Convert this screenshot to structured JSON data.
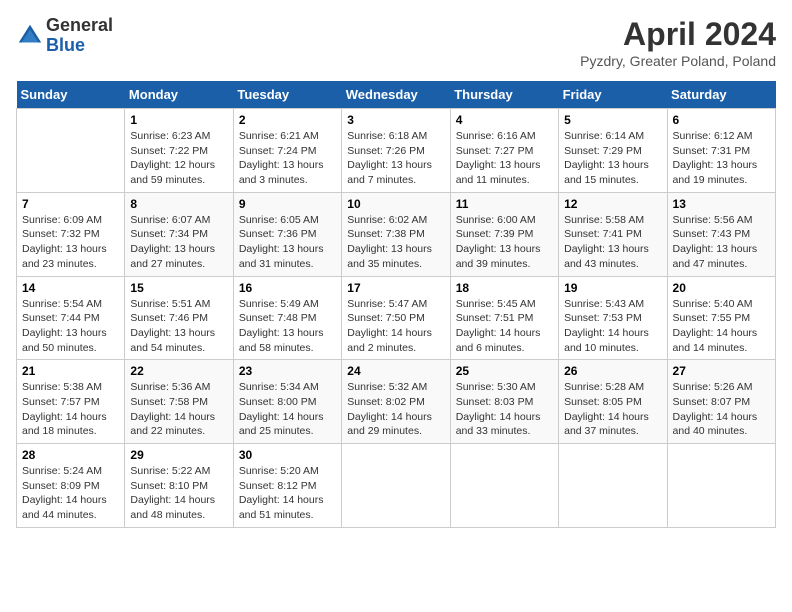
{
  "header": {
    "logo_general": "General",
    "logo_blue": "Blue",
    "title": "April 2024",
    "subtitle": "Pyzdry, Greater Poland, Poland"
  },
  "days_of_week": [
    "Sunday",
    "Monday",
    "Tuesday",
    "Wednesday",
    "Thursday",
    "Friday",
    "Saturday"
  ],
  "weeks": [
    [
      {
        "num": "",
        "sunrise": "",
        "sunset": "",
        "daylight": ""
      },
      {
        "num": "1",
        "sunrise": "Sunrise: 6:23 AM",
        "sunset": "Sunset: 7:22 PM",
        "daylight": "Daylight: 12 hours and 59 minutes."
      },
      {
        "num": "2",
        "sunrise": "Sunrise: 6:21 AM",
        "sunset": "Sunset: 7:24 PM",
        "daylight": "Daylight: 13 hours and 3 minutes."
      },
      {
        "num": "3",
        "sunrise": "Sunrise: 6:18 AM",
        "sunset": "Sunset: 7:26 PM",
        "daylight": "Daylight: 13 hours and 7 minutes."
      },
      {
        "num": "4",
        "sunrise": "Sunrise: 6:16 AM",
        "sunset": "Sunset: 7:27 PM",
        "daylight": "Daylight: 13 hours and 11 minutes."
      },
      {
        "num": "5",
        "sunrise": "Sunrise: 6:14 AM",
        "sunset": "Sunset: 7:29 PM",
        "daylight": "Daylight: 13 hours and 15 minutes."
      },
      {
        "num": "6",
        "sunrise": "Sunrise: 6:12 AM",
        "sunset": "Sunset: 7:31 PM",
        "daylight": "Daylight: 13 hours and 19 minutes."
      }
    ],
    [
      {
        "num": "7",
        "sunrise": "Sunrise: 6:09 AM",
        "sunset": "Sunset: 7:32 PM",
        "daylight": "Daylight: 13 hours and 23 minutes."
      },
      {
        "num": "8",
        "sunrise": "Sunrise: 6:07 AM",
        "sunset": "Sunset: 7:34 PM",
        "daylight": "Daylight: 13 hours and 27 minutes."
      },
      {
        "num": "9",
        "sunrise": "Sunrise: 6:05 AM",
        "sunset": "Sunset: 7:36 PM",
        "daylight": "Daylight: 13 hours and 31 minutes."
      },
      {
        "num": "10",
        "sunrise": "Sunrise: 6:02 AM",
        "sunset": "Sunset: 7:38 PM",
        "daylight": "Daylight: 13 hours and 35 minutes."
      },
      {
        "num": "11",
        "sunrise": "Sunrise: 6:00 AM",
        "sunset": "Sunset: 7:39 PM",
        "daylight": "Daylight: 13 hours and 39 minutes."
      },
      {
        "num": "12",
        "sunrise": "Sunrise: 5:58 AM",
        "sunset": "Sunset: 7:41 PM",
        "daylight": "Daylight: 13 hours and 43 minutes."
      },
      {
        "num": "13",
        "sunrise": "Sunrise: 5:56 AM",
        "sunset": "Sunset: 7:43 PM",
        "daylight": "Daylight: 13 hours and 47 minutes."
      }
    ],
    [
      {
        "num": "14",
        "sunrise": "Sunrise: 5:54 AM",
        "sunset": "Sunset: 7:44 PM",
        "daylight": "Daylight: 13 hours and 50 minutes."
      },
      {
        "num": "15",
        "sunrise": "Sunrise: 5:51 AM",
        "sunset": "Sunset: 7:46 PM",
        "daylight": "Daylight: 13 hours and 54 minutes."
      },
      {
        "num": "16",
        "sunrise": "Sunrise: 5:49 AM",
        "sunset": "Sunset: 7:48 PM",
        "daylight": "Daylight: 13 hours and 58 minutes."
      },
      {
        "num": "17",
        "sunrise": "Sunrise: 5:47 AM",
        "sunset": "Sunset: 7:50 PM",
        "daylight": "Daylight: 14 hours and 2 minutes."
      },
      {
        "num": "18",
        "sunrise": "Sunrise: 5:45 AM",
        "sunset": "Sunset: 7:51 PM",
        "daylight": "Daylight: 14 hours and 6 minutes."
      },
      {
        "num": "19",
        "sunrise": "Sunrise: 5:43 AM",
        "sunset": "Sunset: 7:53 PM",
        "daylight": "Daylight: 14 hours and 10 minutes."
      },
      {
        "num": "20",
        "sunrise": "Sunrise: 5:40 AM",
        "sunset": "Sunset: 7:55 PM",
        "daylight": "Daylight: 14 hours and 14 minutes."
      }
    ],
    [
      {
        "num": "21",
        "sunrise": "Sunrise: 5:38 AM",
        "sunset": "Sunset: 7:57 PM",
        "daylight": "Daylight: 14 hours and 18 minutes."
      },
      {
        "num": "22",
        "sunrise": "Sunrise: 5:36 AM",
        "sunset": "Sunset: 7:58 PM",
        "daylight": "Daylight: 14 hours and 22 minutes."
      },
      {
        "num": "23",
        "sunrise": "Sunrise: 5:34 AM",
        "sunset": "Sunset: 8:00 PM",
        "daylight": "Daylight: 14 hours and 25 minutes."
      },
      {
        "num": "24",
        "sunrise": "Sunrise: 5:32 AM",
        "sunset": "Sunset: 8:02 PM",
        "daylight": "Daylight: 14 hours and 29 minutes."
      },
      {
        "num": "25",
        "sunrise": "Sunrise: 5:30 AM",
        "sunset": "Sunset: 8:03 PM",
        "daylight": "Daylight: 14 hours and 33 minutes."
      },
      {
        "num": "26",
        "sunrise": "Sunrise: 5:28 AM",
        "sunset": "Sunset: 8:05 PM",
        "daylight": "Daylight: 14 hours and 37 minutes."
      },
      {
        "num": "27",
        "sunrise": "Sunrise: 5:26 AM",
        "sunset": "Sunset: 8:07 PM",
        "daylight": "Daylight: 14 hours and 40 minutes."
      }
    ],
    [
      {
        "num": "28",
        "sunrise": "Sunrise: 5:24 AM",
        "sunset": "Sunset: 8:09 PM",
        "daylight": "Daylight: 14 hours and 44 minutes."
      },
      {
        "num": "29",
        "sunrise": "Sunrise: 5:22 AM",
        "sunset": "Sunset: 8:10 PM",
        "daylight": "Daylight: 14 hours and 48 minutes."
      },
      {
        "num": "30",
        "sunrise": "Sunrise: 5:20 AM",
        "sunset": "Sunset: 8:12 PM",
        "daylight": "Daylight: 14 hours and 51 minutes."
      },
      {
        "num": "",
        "sunrise": "",
        "sunset": "",
        "daylight": ""
      },
      {
        "num": "",
        "sunrise": "",
        "sunset": "",
        "daylight": ""
      },
      {
        "num": "",
        "sunrise": "",
        "sunset": "",
        "daylight": ""
      },
      {
        "num": "",
        "sunrise": "",
        "sunset": "",
        "daylight": ""
      }
    ]
  ]
}
